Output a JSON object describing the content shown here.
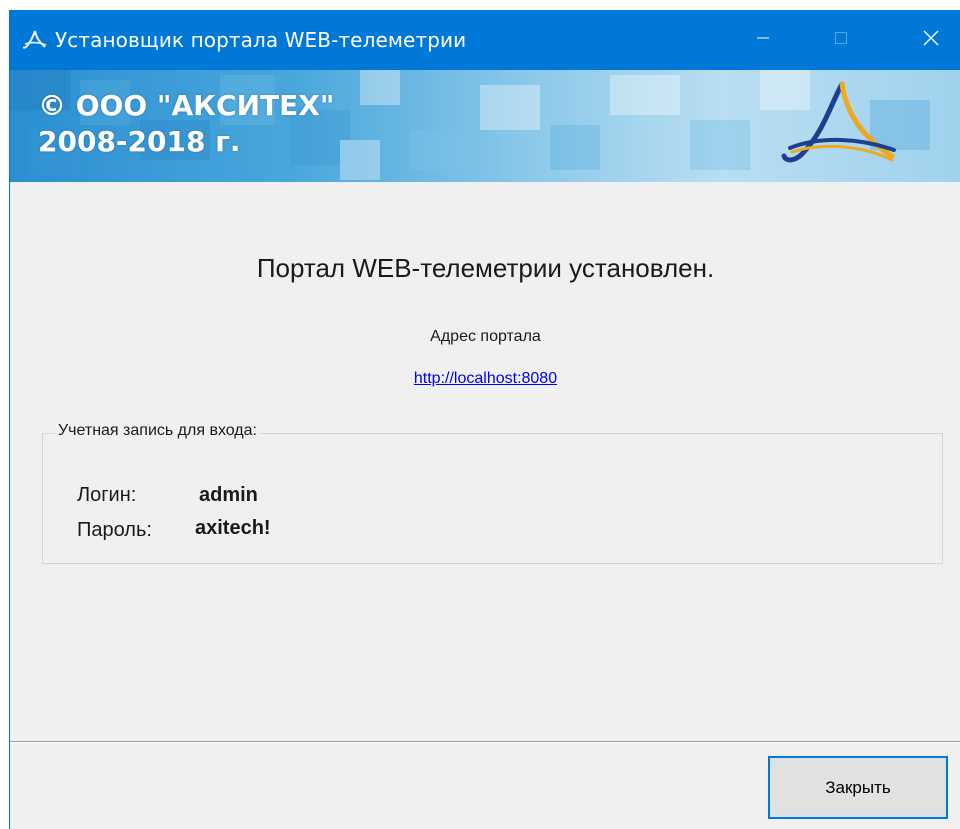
{
  "window": {
    "title": "Установщик портала WEB-телеметрии",
    "accent_color": "#0078d7",
    "icons": {
      "app": "axitech-logo-icon",
      "minimize": "minimize-icon",
      "maximize": "maximize-icon",
      "close": "close-icon"
    }
  },
  "banner": {
    "line1": "© ООО \"АКСИТЕХ\"",
    "line2": "2008-2018 г."
  },
  "main": {
    "heading": "Портал WEB-телеметрии установлен.",
    "address_label": "Адрес портала",
    "address_link": "http://localhost:8080"
  },
  "credentials": {
    "legend": "Учетная запись для входа:",
    "login_label": "Логин:",
    "login_value": "admin",
    "password_label": "Пароль:",
    "password_value": "axitech!"
  },
  "footer": {
    "close_label": "Закрыть"
  }
}
